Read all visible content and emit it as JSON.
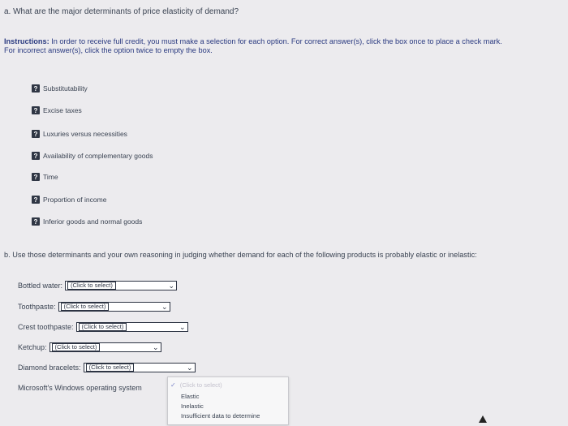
{
  "question_a": "a. What are the major determinants of price elasticity of demand?",
  "instructions": {
    "label": "Instructions:",
    "text": "In order to receive full credit, you must make a selection for each option. For correct answer(s), click the box once to place a check mark. For incorrect answer(s), click the option twice to empty the box."
  },
  "options": [
    {
      "label": "Substitutability",
      "box": "?"
    },
    {
      "label": "Excise taxes",
      "box": "?"
    },
    {
      "label": "Luxuries versus necessities",
      "box": "?"
    },
    {
      "label": "Availability of complementary goods",
      "box": "?"
    },
    {
      "label": "Time",
      "box": "?"
    },
    {
      "label": "Proportion of income",
      "box": "?"
    },
    {
      "label": "Inferior goods and normal goods",
      "box": "?"
    }
  ],
  "question_b": "b. Use those determinants and your own reasoning in judging whether demand for each of the following products is probably elastic or inelastic:",
  "products": [
    {
      "label": "Bottled water:",
      "select": "(Click to select)"
    },
    {
      "label": "Toothpaste:",
      "select": "(Click to select)"
    },
    {
      "label": "Crest toothpaste:",
      "select": "(Click to select)"
    },
    {
      "label": "Ketchup:",
      "select": "(Click to select)"
    },
    {
      "label": "Diamond bracelets:",
      "select": "(Click to select)"
    },
    {
      "label": "Microsoft's Windows operating system"
    }
  ],
  "dropdown": {
    "header": "(Click to select)",
    "check": "✓",
    "options": [
      "Elastic",
      "Inelastic",
      "Insufficient data to determine"
    ]
  }
}
